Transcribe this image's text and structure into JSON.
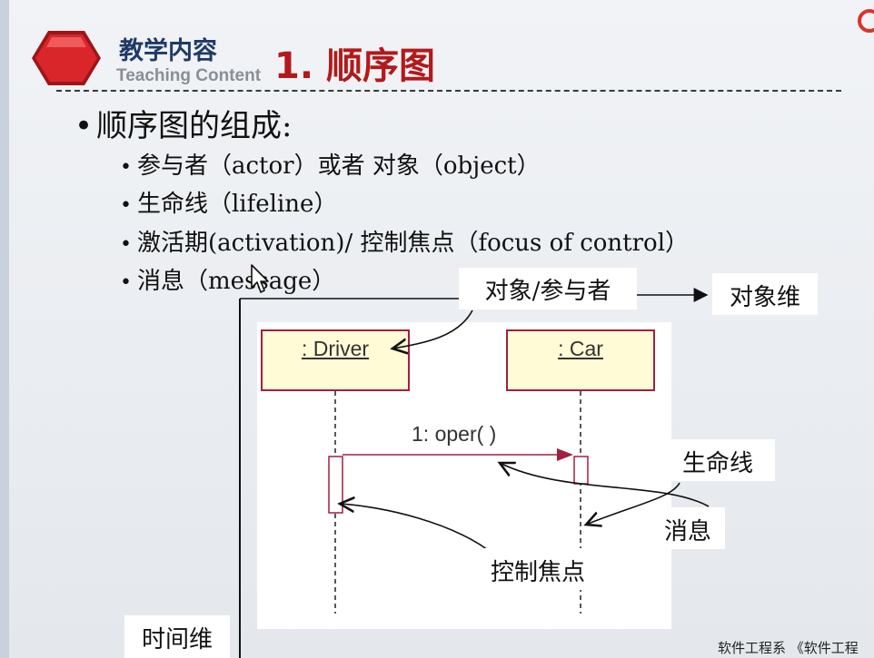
{
  "header": {
    "section_cn": "教学内容",
    "section_en": "Teaching Content",
    "title": "1. 顺序图"
  },
  "content": {
    "main_bullet": "顺序图的组成:",
    "sub_bullets": [
      "参与者（actor）或者 对象（object）",
      "生命线（lifeline）",
      "激活期(activation)/ 控制焦点（focus of control）",
      "消息（message）"
    ]
  },
  "diagram": {
    "objects": [
      ": Driver",
      ": Car"
    ],
    "message": "1: oper( )"
  },
  "callouts": {
    "object_actor": "对象/参与者",
    "object_dimension": "对象维",
    "lifeline": "生命线",
    "message": "消息",
    "focus_of_control": "控制焦点",
    "time_dimension": "时间维"
  },
  "footer": "软件工程系  《软件工程",
  "colors": {
    "title_red": "#b3191b",
    "header_navy": "#1f3a66",
    "uml_border": "#a12042",
    "uml_fill": "#fefbd6"
  }
}
